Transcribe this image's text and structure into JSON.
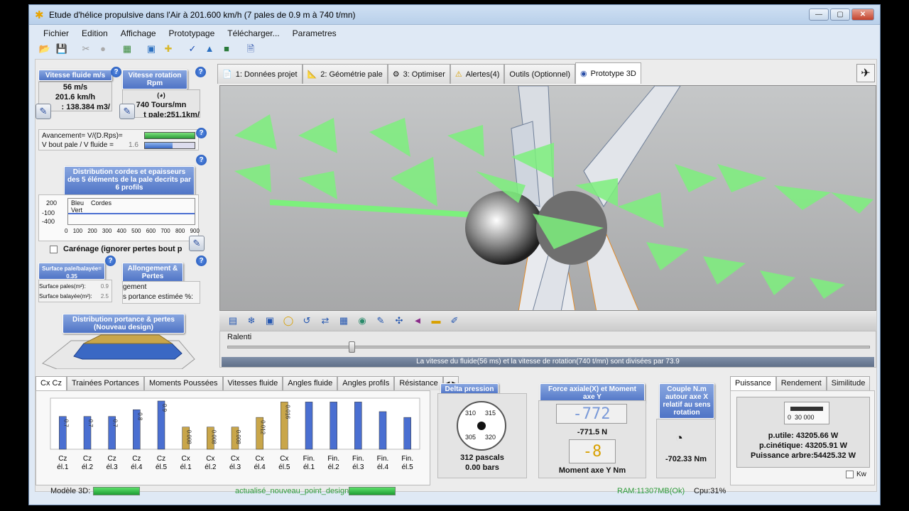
{
  "window": {
    "title": "Etude d'hélice propulsive dans l'Air à 201.600 km/h (7 pales de 0.9 m à 740 t/mn)",
    "btn_min": "—",
    "btn_max": "▢",
    "btn_close": "✕"
  },
  "menu": [
    "Fichier",
    "Edition",
    "Affichage",
    "Prototypage",
    "Télécharger...",
    "Parametres"
  ],
  "left": {
    "fluid_speed_hdr": "Vitesse fluide m/s",
    "fluid_speed_l1": "56 m/s",
    "fluid_speed_l2": "201.6 km/h",
    "fluid_speed_l3": ": 138.384 m3/",
    "rotation_hdr": "Vitesse rotation Rpm",
    "rotation_l1": "740 Tours/mn",
    "rotation_l2": "t pale:251.1km/",
    "advance_label": "Avancement= V/(D.Rps)=",
    "vtip_label": "V bout pale / V fluide =",
    "vtip_value": "1.6",
    "distrib_hdr": "Distribution cordes et epaisseurs des 5 éléments de la pale decrits par 6 profils",
    "distrib_legend_1": "Bleu",
    "distrib_legend_2": "Cordes",
    "distrib_legend_3": "Vert",
    "distrib_y_ticks": [
      "200",
      "-100",
      "-400"
    ],
    "distrib_x_ticks": [
      "0",
      "100",
      "200",
      "300",
      "400",
      "500",
      "600",
      "700",
      "800",
      "900"
    ],
    "carenage_label": "Carénage (ignorer pertes bout p",
    "surface_hdr": "Surface pale/balayée= 0.35",
    "surface_l1": "Surface pales(m²):",
    "surface_v1": "0.9",
    "surface_l2": "Surface balayée(m²):",
    "surface_v2": "2.5",
    "allongement_hdr": "Allongement & Pertes",
    "allongement_l1": "gement",
    "allongement_l2": "s portance estimée %:",
    "portance_hdr": "Distribution portance & pertes (Nouveau design)"
  },
  "tabs_top": [
    {
      "label": "1: Données projet",
      "icon": "📄"
    },
    {
      "label": "2: Géométrie pale",
      "icon": "📐"
    },
    {
      "label": "3: Optimiser",
      "icon": "⚙"
    },
    {
      "label": "Alertes(4)",
      "icon": "⚠"
    },
    {
      "label": "Outils (Optionnel)",
      "icon": ""
    },
    {
      "label": "Prototype 3D",
      "icon": "◉"
    }
  ],
  "viewport": {
    "slow_label": "Ralenti",
    "slow_level": 0.19,
    "info_text": "La vitesse du fluide(56 ms) et la vitesse de rotation(740 t/mn) sont divisées par 73.9"
  },
  "bottom_tabs": [
    "Cx Cz",
    "Trainées Portances",
    "Moments Poussées",
    "Vitesses fluide",
    "Angles fluide",
    "Angles profils",
    "Résistance"
  ],
  "chart_data": {
    "type": "bar",
    "categories": [
      "Cz él.1",
      "Cz él.2",
      "Cz él.3",
      "Cz él.4",
      "Cz él.5",
      "Cx él.1",
      "Cx él.2",
      "Cx él.3",
      "Cx él.4",
      "Cx él.5",
      "Fin. él.1",
      "Fin. él.2",
      "Fin. él.3",
      "Fin. él.4",
      "Fin. él.5"
    ],
    "cat_line1": [
      "Cz",
      "Cz",
      "Cz",
      "Cz",
      "Cz",
      "Cx",
      "Cx",
      "Cx",
      "Cx",
      "Cx",
      "Fin.",
      "Fin.",
      "Fin.",
      "Fin.",
      "Fin."
    ],
    "cat_line2": [
      "él.1",
      "él.2",
      "él.3",
      "él.4",
      "él.5",
      "él.1",
      "él.2",
      "él.3",
      "él.4",
      "él.5",
      "él.1",
      "él.2",
      "él.3",
      "él.4",
      "él.5"
    ],
    "values": [
      0.68,
      0.68,
      0.68,
      0.82,
      1.0,
      0.46,
      0.46,
      0.46,
      0.66,
      0.98,
      0.98,
      0.98,
      0.98,
      0.78,
      0.66
    ],
    "bar_labels": [
      "0.7",
      "0.7",
      "0.7",
      "0.8",
      "0.9",
      "0.008",
      "0.008",
      "0.008",
      "0.012",
      "0.016",
      "",
      "",
      "",
      "",
      ""
    ],
    "bar_colors": [
      "#4a6fd1",
      "#4a6fd1",
      "#4a6fd1",
      "#4a6fd1",
      "#4a6fd1",
      "#c9a64a",
      "#c9a64a",
      "#c9a64a",
      "#c9a64a",
      "#c9a64a",
      "#4a6fd1",
      "#4a6fd1",
      "#4a6fd1",
      "#4a6fd1",
      "#4a6fd1"
    ]
  },
  "delta_pression": {
    "hdr": "Delta pression",
    "ticks": [
      "310",
      "315",
      "305",
      "320"
    ],
    "line1": "312 pascals",
    "line2": "0.00 bars"
  },
  "force": {
    "hdr": "Force axiale(X) et Moment axe Y",
    "display1": "-772",
    "value1": "-771.5 N",
    "display2": "-8",
    "label2": "Moment axe Y Nm"
  },
  "couple": {
    "hdr": "Couple N.m autour axe X relatif au sens rotation",
    "value": "-702.33 Nm"
  },
  "right_tabs": [
    "Puissance",
    "Rendement",
    "Similitude"
  ],
  "puissance": {
    "scale": "0  30 000",
    "l1": "p.utile: 43205.66 W",
    "l2": "p.cinétique: 43205.91 W",
    "l3": "Puissance arbre:54425.32 W",
    "unit": "Kw"
  },
  "status": {
    "model_label": "Modèle 3D:",
    "center_text": "actualisé_nouveau_point_design",
    "ram": "RAM:11307MB(Ok)",
    "cpu": "Cpu:31%"
  },
  "colors": {
    "accent_blue": "#4f74c6",
    "green_arrow": "#7cf07c",
    "status_green": "#2e9b3b"
  }
}
